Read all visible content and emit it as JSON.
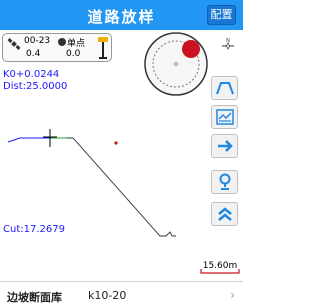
{
  "header": {
    "title": "道路放样",
    "config_label": "配置"
  },
  "status": {
    "satellites_used": "00-23",
    "hdop": "0.4",
    "mode_label": "单点",
    "age": "0.0"
  },
  "readout": {
    "station": "K0+0.0244",
    "distance": "Dist:25.0000"
  },
  "cut": "Cut:17.2679",
  "scale": "15.60m",
  "footer": {
    "library_label": "边坡断面库",
    "library_value": "k10-20",
    "arrow": "›"
  },
  "icons": [
    "satellite-icon",
    "survey-pole-icon",
    "north-compass-icon",
    "cross-section-icon",
    "chart-icon",
    "arrow-right-icon",
    "location-pin-icon",
    "double-chevron-up-icon"
  ],
  "colors": {
    "header": "#2196f3",
    "text_blue": "#1a1aff",
    "target_red": "#cc1122",
    "tool_blue": "#1e88e5"
  }
}
